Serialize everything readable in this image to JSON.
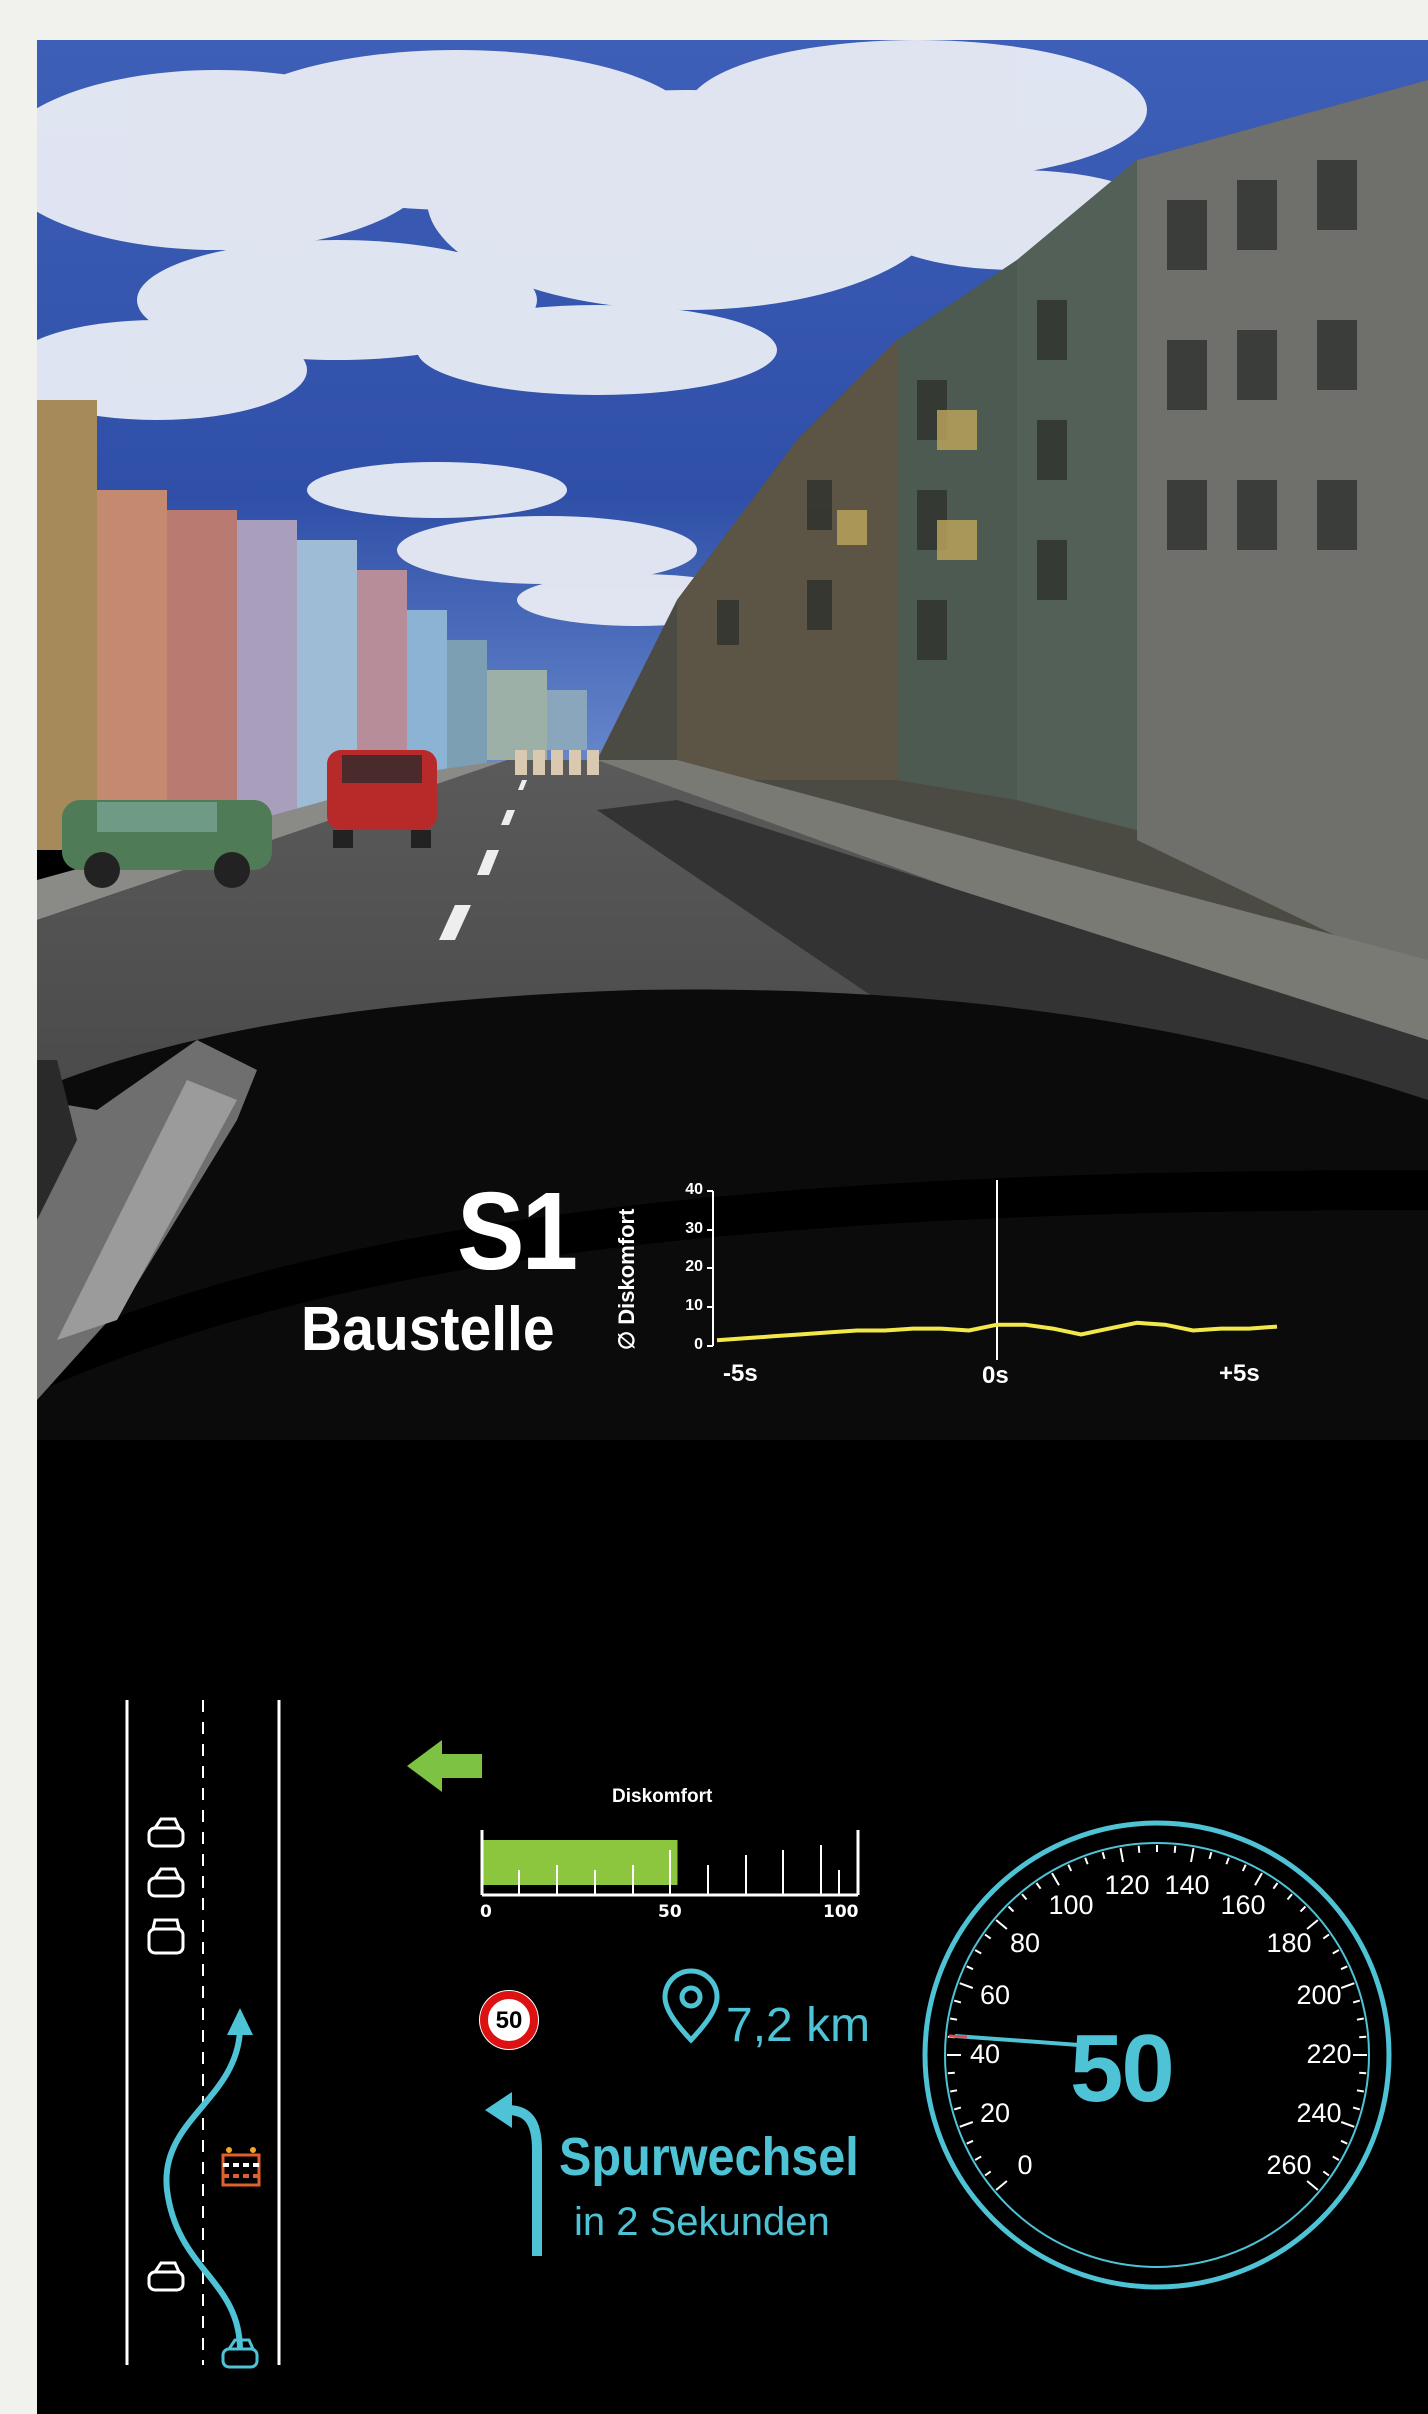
{
  "scenario": {
    "id": "S1",
    "name": "Baustelle"
  },
  "discomfort_plot": {
    "ylabel": "∅ Diskomfort",
    "yticks": [
      "40",
      "30",
      "20",
      "10",
      "0"
    ],
    "xticks": [
      "-5s",
      "0s",
      "+5s"
    ],
    "line_color": "#f2e84a"
  },
  "chart_data": {
    "type": "line",
    "title": "",
    "xlabel": "",
    "ylabel": "∅ Diskomfort",
    "ylim": [
      0,
      40
    ],
    "xlim": [
      -5,
      5
    ],
    "grid": false,
    "x": [
      -5,
      -4.5,
      -4,
      -3.5,
      -3,
      -2.5,
      -2,
      -1.5,
      -1,
      -0.5,
      0,
      0.5,
      1,
      1.5,
      2,
      2.5,
      3,
      3.5,
      4,
      4.5,
      5
    ],
    "series": [
      {
        "values": [
          1.5,
          2.0,
          2.5,
          3.0,
          3.5,
          4.0,
          4.0,
          4.5,
          4.5,
          4.0,
          5.5,
          5.5,
          4.5,
          3.0,
          4.5,
          6.0,
          5.5,
          4.0,
          4.5,
          4.5,
          5.0
        ]
      }
    ]
  },
  "hud": {
    "discomfort_bar": {
      "title": "Diskomfort",
      "value": 52,
      "max": 100,
      "tick_labels": [
        "0",
        "50",
        "100"
      ],
      "fill_color": "#8cc63f"
    },
    "speed_limit_sign": "50",
    "distance": "7,2 km",
    "instruction": {
      "title": "Spurwechsel",
      "subtitle": "in 2 Sekunden"
    },
    "speedometer": {
      "value": "50",
      "labels": [
        "0",
        "20",
        "40",
        "60",
        "80",
        "100",
        "120",
        "140",
        "160",
        "180",
        "200",
        "220",
        "240",
        "260"
      ],
      "color": "#4ec3d6"
    },
    "lane_arrow_color": "#7dc242",
    "accent_color": "#4ec3d6"
  },
  "icons": [
    "left-arrow-icon",
    "car-icon",
    "construction-barrier-icon",
    "location-pin-icon",
    "turn-left-arrow-icon"
  ]
}
